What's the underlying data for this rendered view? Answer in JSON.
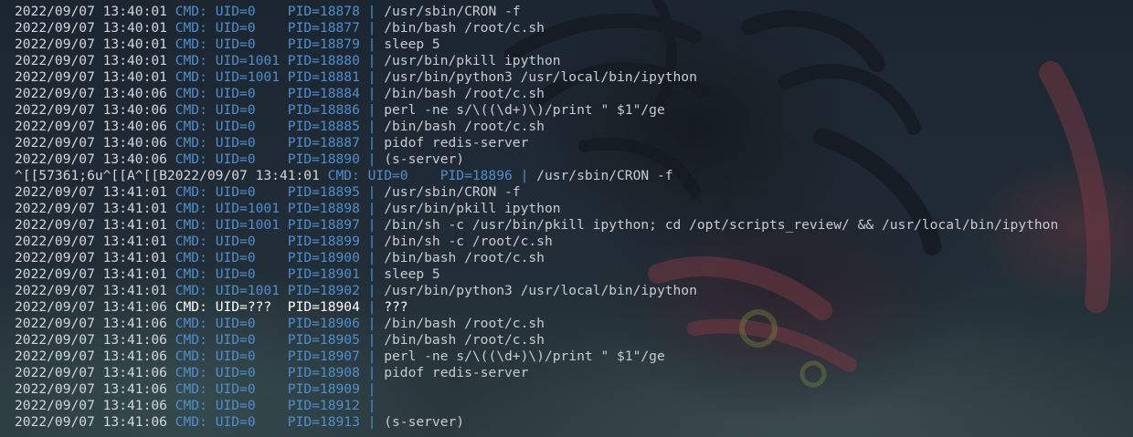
{
  "colors": {
    "timestamp": "#d3d7dc",
    "key": "#4e8fcf",
    "value": "#c7ccd2",
    "background": "#1b2530"
  },
  "terminal": {
    "lines": [
      {
        "ts": "2022/09/07 13:40:01",
        "cmd": "CMD:",
        "uid": "UID=0   ",
        "pid": "PID=18878",
        "sep": " | ",
        "command": "/usr/sbin/CRON -f"
      },
      {
        "ts": "2022/09/07 13:40:01",
        "cmd": "CMD:",
        "uid": "UID=0   ",
        "pid": "PID=18877",
        "sep": " | ",
        "command": "/bin/bash /root/c.sh"
      },
      {
        "ts": "2022/09/07 13:40:01",
        "cmd": "CMD:",
        "uid": "UID=0   ",
        "pid": "PID=18879",
        "sep": " | ",
        "command": "sleep 5"
      },
      {
        "ts": "2022/09/07 13:40:01",
        "cmd": "CMD:",
        "uid": "UID=1001",
        "pid": "PID=18880",
        "sep": " | ",
        "command": "/usr/bin/pkill ipython"
      },
      {
        "ts": "2022/09/07 13:40:01",
        "cmd": "CMD:",
        "uid": "UID=1001",
        "pid": "PID=18881",
        "sep": " | ",
        "command": "/usr/bin/python3 /usr/local/bin/ipython"
      },
      {
        "ts": "2022/09/07 13:40:06",
        "cmd": "CMD:",
        "uid": "UID=0   ",
        "pid": "PID=18884",
        "sep": " | ",
        "command": "/bin/bash /root/c.sh"
      },
      {
        "ts": "2022/09/07 13:40:06",
        "cmd": "CMD:",
        "uid": "UID=0   ",
        "pid": "PID=18886",
        "sep": " | ",
        "command": "perl -ne s/\\((\\d+)\\)/print \" $1\"/ge"
      },
      {
        "ts": "2022/09/07 13:40:06",
        "cmd": "CMD:",
        "uid": "UID=0   ",
        "pid": "PID=18885",
        "sep": " | ",
        "command": "/bin/bash /root/c.sh"
      },
      {
        "ts": "2022/09/07 13:40:06",
        "cmd": "CMD:",
        "uid": "UID=0   ",
        "pid": "PID=18887",
        "sep": " | ",
        "command": "pidof redis-server"
      },
      {
        "ts": "2022/09/07 13:40:06",
        "cmd": "CMD:",
        "uid": "UID=0   ",
        "pid": "PID=18890",
        "sep": " | ",
        "command": "(s-server)"
      },
      {
        "ts": "^[[57361;6u^[[A^[[B2022/09/07 13:41:01",
        "cmd": "CMD:",
        "uid": "UID=0   ",
        "pid": "PID=18896",
        "sep": " | ",
        "command": "/usr/sbin/CRON -f"
      },
      {
        "ts": "2022/09/07 13:41:01",
        "cmd": "CMD:",
        "uid": "UID=0   ",
        "pid": "PID=18895",
        "sep": " | ",
        "command": "/usr/sbin/CRON -f"
      },
      {
        "ts": "2022/09/07 13:41:01",
        "cmd": "CMD:",
        "uid": "UID=1001",
        "pid": "PID=18898",
        "sep": " | ",
        "command": "/usr/bin/pkill ipython"
      },
      {
        "ts": "2022/09/07 13:41:01",
        "cmd": "CMD:",
        "uid": "UID=1001",
        "pid": "PID=18897",
        "sep": " | ",
        "command": "/bin/sh -c /usr/bin/pkill ipython; cd /opt/scripts_review/ && /usr/local/bin/ipython"
      },
      {
        "ts": "2022/09/07 13:41:01",
        "cmd": "CMD:",
        "uid": "UID=0   ",
        "pid": "PID=18899",
        "sep": " | ",
        "command": "/bin/sh -c /root/c.sh"
      },
      {
        "ts": "2022/09/07 13:41:01",
        "cmd": "CMD:",
        "uid": "UID=0   ",
        "pid": "PID=18900",
        "sep": " | ",
        "command": "/bin/bash /root/c.sh"
      },
      {
        "ts": "2022/09/07 13:41:01",
        "cmd": "CMD:",
        "uid": "UID=0   ",
        "pid": "PID=18901",
        "sep": " | ",
        "command": "sleep 5"
      },
      {
        "ts": "2022/09/07 13:41:01",
        "cmd": "CMD:",
        "uid": "UID=1001",
        "pid": "PID=18902",
        "sep": " | ",
        "command": "/usr/bin/python3 /usr/local/bin/ipython"
      },
      {
        "ts": "2022/09/07 13:41:06",
        "cmd": "CMD:",
        "uid": "UID=???",
        "pid": " PID=18904",
        "sep": " | ",
        "command": "???",
        "highlight": true
      },
      {
        "ts": "2022/09/07 13:41:06",
        "cmd": "CMD:",
        "uid": "UID=0   ",
        "pid": "PID=18906",
        "sep": " | ",
        "command": "/bin/bash /root/c.sh"
      },
      {
        "ts": "2022/09/07 13:41:06",
        "cmd": "CMD:",
        "uid": "UID=0   ",
        "pid": "PID=18905",
        "sep": " | ",
        "command": "/bin/bash /root/c.sh"
      },
      {
        "ts": "2022/09/07 13:41:06",
        "cmd": "CMD:",
        "uid": "UID=0   ",
        "pid": "PID=18907",
        "sep": " | ",
        "command": "perl -ne s/\\((\\d+)\\)/print \" $1\"/ge"
      },
      {
        "ts": "2022/09/07 13:41:06",
        "cmd": "CMD:",
        "uid": "UID=0   ",
        "pid": "PID=18908",
        "sep": " | ",
        "command": "pidof redis-server"
      },
      {
        "ts": "2022/09/07 13:41:06",
        "cmd": "CMD:",
        "uid": "UID=0   ",
        "pid": "PID=18909",
        "sep": " | ",
        "command": ""
      },
      {
        "ts": "2022/09/07 13:41:06",
        "cmd": "CMD:",
        "uid": "UID=0   ",
        "pid": "PID=18912",
        "sep": " | ",
        "command": ""
      },
      {
        "ts": "2022/09/07 13:41:06",
        "cmd": "CMD:",
        "uid": "UID=0   ",
        "pid": "PID=18913",
        "sep": " | ",
        "command": "(s-server)"
      }
    ]
  }
}
